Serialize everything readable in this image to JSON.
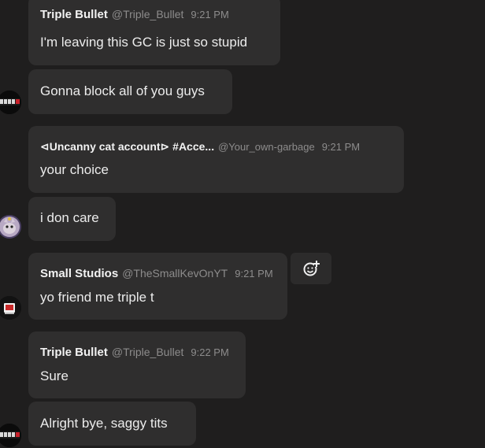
{
  "messages": [
    {
      "author": "Triple Bullet",
      "handle": "@Triple_Bullet",
      "time": "9:21 PM",
      "lines": [
        "I'm leaving this GC is just so stupid",
        "Gonna block all of you guys"
      ]
    },
    {
      "author": "⊲Uncanny cat account⊳ #Acce...",
      "handle": "@Your_own-garbage",
      "time": "9:21 PM",
      "lines": [
        "your choice",
        "i don care"
      ]
    },
    {
      "author": "Small Studios",
      "handle": "@TheSmallKevOnYT",
      "time": "9:21 PM",
      "lines": [
        "yo friend me triple t"
      ]
    },
    {
      "author": "Triple Bullet",
      "handle": "@Triple_Bullet",
      "time": "9:22 PM",
      "lines": [
        "Sure",
        "Alright bye, saggy tits"
      ]
    }
  ],
  "actions": {
    "add_reaction_icon": "add-reaction-icon"
  },
  "colors": {
    "background": "#1f1e1e",
    "bubble": "#2f2e2e",
    "author_text": "#f2f2f2",
    "meta_text": "#8d8c8c",
    "body_text": "#ececec"
  }
}
